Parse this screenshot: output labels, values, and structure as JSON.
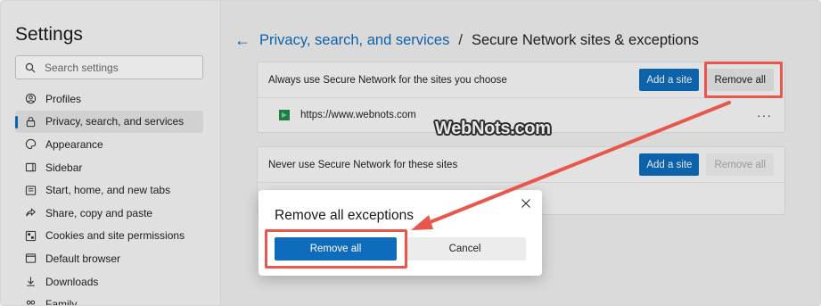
{
  "sidebar": {
    "title": "Settings",
    "search_placeholder": "Search settings",
    "items": [
      {
        "label": "Profiles",
        "icon": "profile-icon"
      },
      {
        "label": "Privacy, search, and services",
        "icon": "lock-icon",
        "active": true
      },
      {
        "label": "Appearance",
        "icon": "appearance-icon"
      },
      {
        "label": "Sidebar",
        "icon": "sidebar-icon"
      },
      {
        "label": "Start, home, and new tabs",
        "icon": "home-icon"
      },
      {
        "label": "Share, copy and paste",
        "icon": "share-icon"
      },
      {
        "label": "Cookies and site permissions",
        "icon": "cookies-icon"
      },
      {
        "label": "Default browser",
        "icon": "browser-icon"
      },
      {
        "label": "Downloads",
        "icon": "download-icon"
      },
      {
        "label": "Family",
        "icon": "family-icon"
      }
    ]
  },
  "header": {
    "back_icon": "back-arrow-icon",
    "link": "Privacy, search, and services",
    "separator": "/",
    "current": "Secure Network sites & exceptions"
  },
  "always_card": {
    "label": "Always use Secure Network for the sites you choose",
    "add_label": "Add a site",
    "remove_label": "Remove all",
    "site_url": "https://www.webnots.com",
    "more_label": "···"
  },
  "never_card": {
    "label": "Never use Secure Network for these sites",
    "add_label": "Add a site",
    "remove_label": "Remove all"
  },
  "dialog": {
    "title": "Remove all exceptions",
    "confirm_label": "Remove all",
    "cancel_label": "Cancel"
  },
  "watermark": "WebNots.com",
  "colors": {
    "accent": "#0f6cbd",
    "highlight": "#e8574b"
  }
}
